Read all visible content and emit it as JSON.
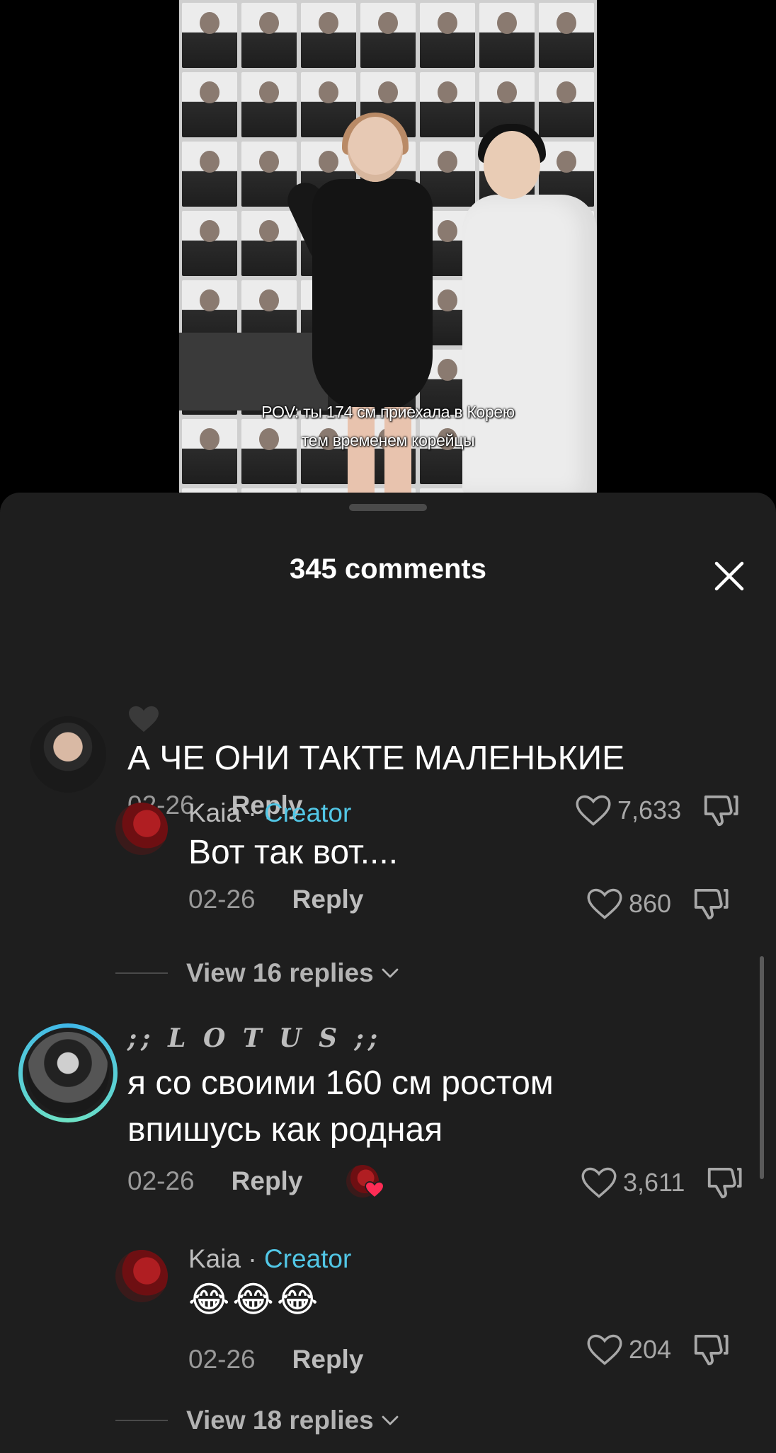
{
  "video": {
    "caption_line1": "POV: ты 174 см приехала в Корею",
    "caption_line2": "тем временем корейцы"
  },
  "sheet": {
    "title": "345 comments",
    "close_icon": "close-icon"
  },
  "comments": [
    {
      "author": "",
      "badge_icon": "black-heart-icon",
      "text": "А ЧЕ ОНИ ТАКТЕ МАЛЕНЬКИЕ",
      "date": "02-26",
      "reply_label": "Reply",
      "likes": "7,633"
    },
    {
      "author": "Kaia",
      "separator": "·",
      "creator_label": "Creator",
      "text": "Вот так вот....",
      "date": "02-26",
      "reply_label": "Reply",
      "likes": "860"
    },
    {
      "author": ";; L O T U S ;;",
      "text": "я со своими 160 см ростом впишусь как родная",
      "date": "02-26",
      "reply_label": "Reply",
      "likes": "3,611"
    },
    {
      "author": "Kaia",
      "separator": "·",
      "creator_label": "Creator",
      "text": "😂😂😂",
      "date": "02-26",
      "reply_label": "Reply",
      "likes": "204"
    }
  ],
  "view_replies": [
    {
      "label": "View 16 replies"
    },
    {
      "label": "View 18 replies"
    }
  ],
  "colors": {
    "sheet_bg": "#1e1e1e",
    "creator_accent": "#52c7e6",
    "avatar_ring_gradient": [
      "#3fb7e9",
      "#6fe3c4"
    ]
  }
}
